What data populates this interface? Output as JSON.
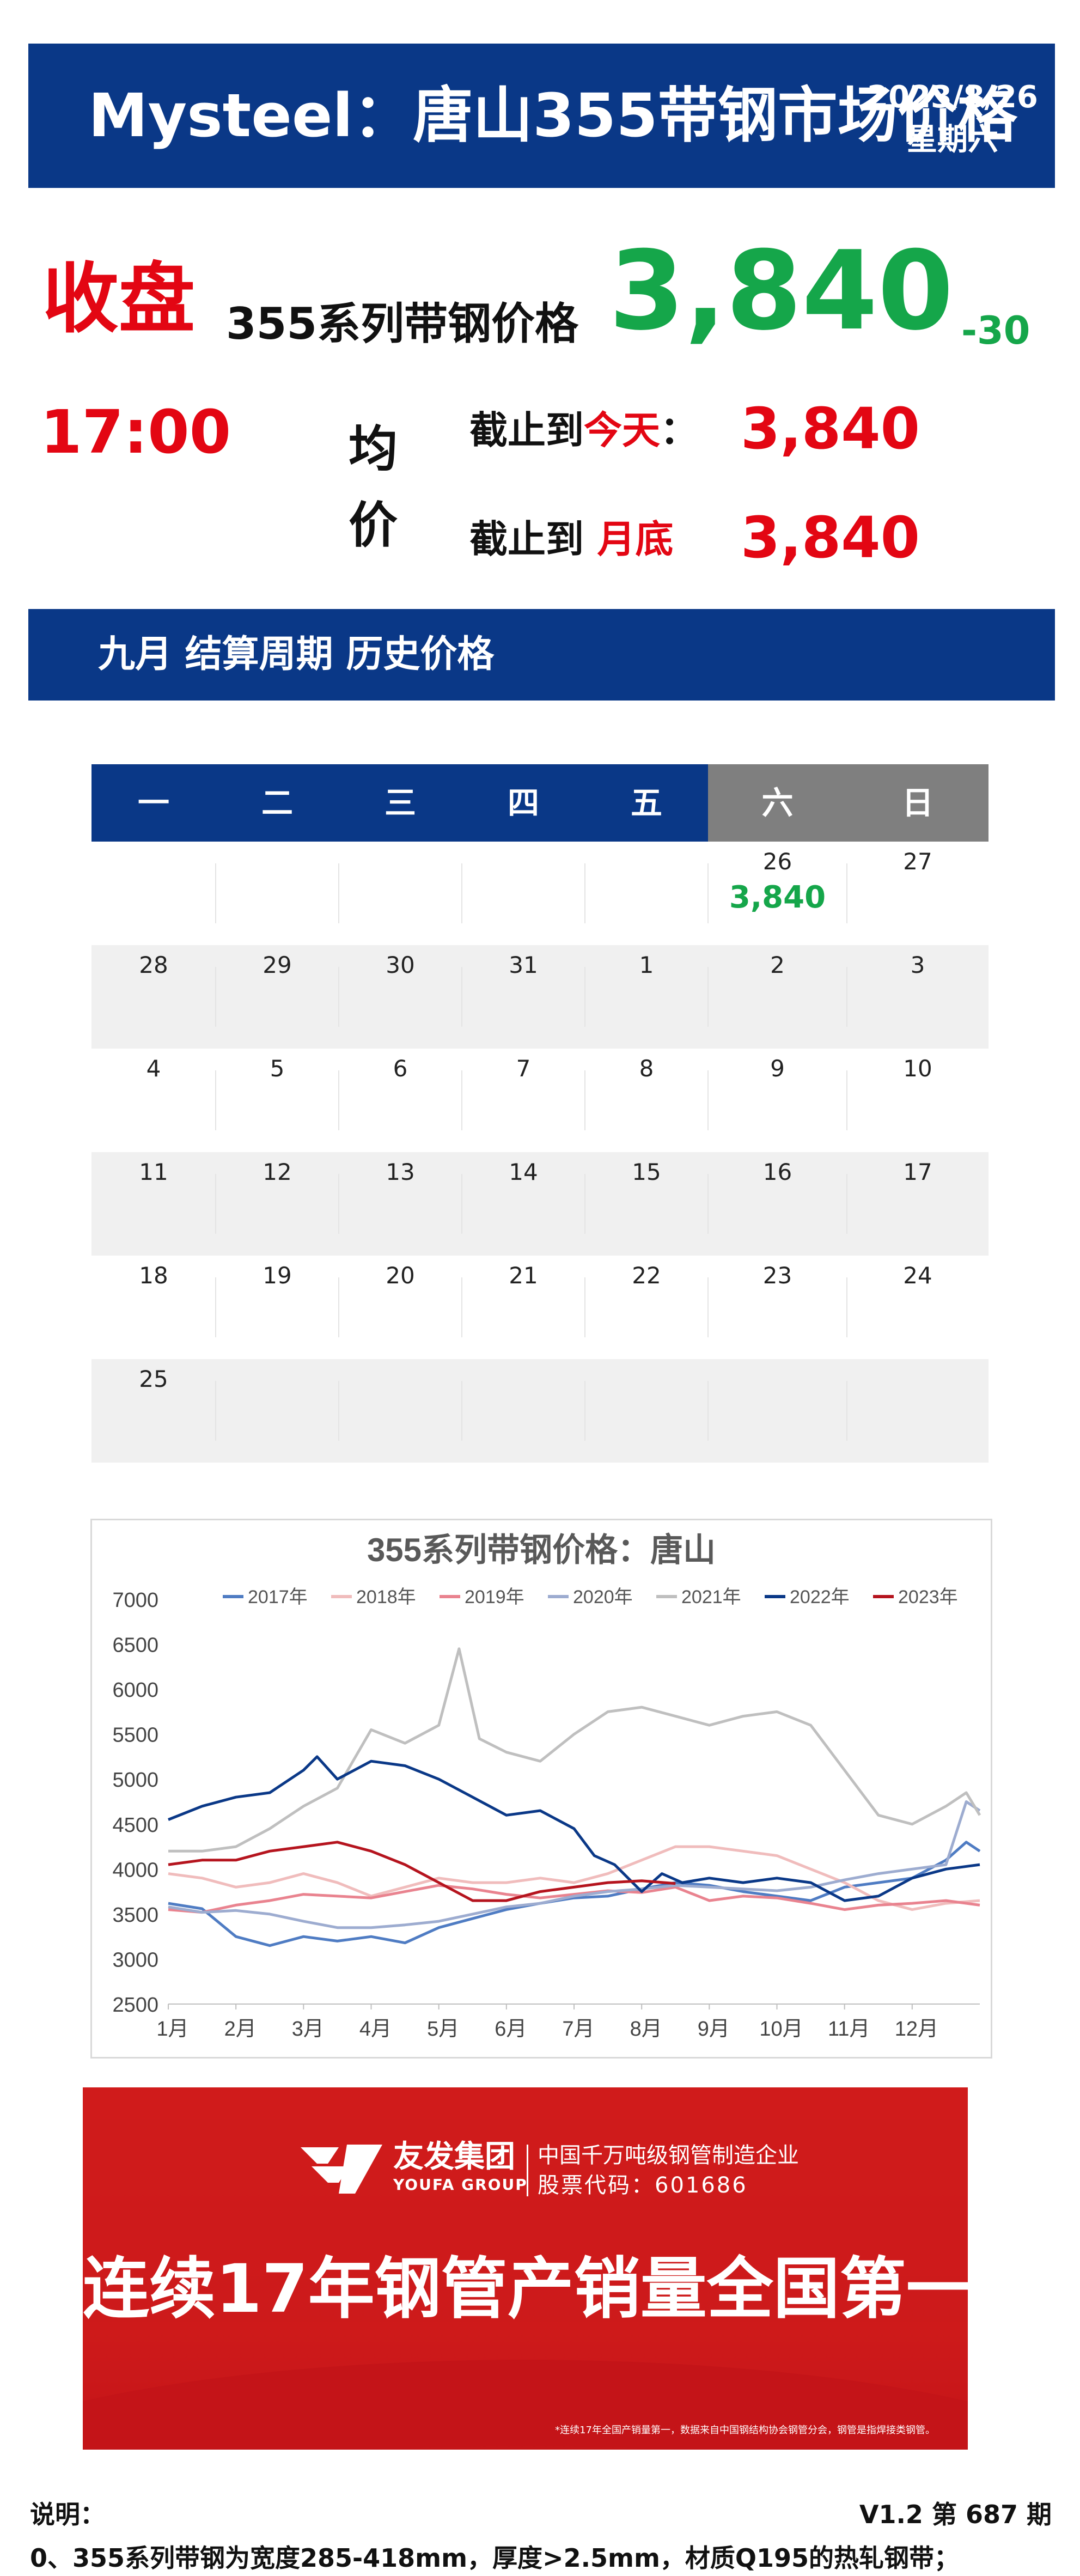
{
  "header": {
    "title": "Mysteel：唐山355带钢市场价格",
    "date": "2023/8/26",
    "weekday": "星期六"
  },
  "price": {
    "close_label": "收盘",
    "time": "17:00",
    "series_label": "355系列带钢价格",
    "value": "3,840",
    "change": "-30",
    "avg_label_1": "均",
    "avg_label_2": "价",
    "today_prefix": "截止到",
    "today_highlight": "今天",
    "today_colon": "：",
    "today_value": "3,840",
    "month_prefix": "截止到",
    "month_highlight": "月底",
    "month_value": "3,840"
  },
  "section": {
    "title": "九月 结算周期 历史价格"
  },
  "calendar": {
    "weekdays": [
      "一",
      "二",
      "三",
      "四",
      "五",
      "六",
      "日"
    ],
    "rows": [
      [
        {
          "day": ""
        },
        {
          "day": ""
        },
        {
          "day": ""
        },
        {
          "day": ""
        },
        {
          "day": ""
        },
        {
          "day": "26",
          "price": "3,840"
        },
        {
          "day": "27"
        }
      ],
      [
        {
          "day": "28"
        },
        {
          "day": "29"
        },
        {
          "day": "30"
        },
        {
          "day": "31"
        },
        {
          "day": "1"
        },
        {
          "day": "2"
        },
        {
          "day": "3"
        }
      ],
      [
        {
          "day": "4"
        },
        {
          "day": "5"
        },
        {
          "day": "6"
        },
        {
          "day": "7"
        },
        {
          "day": "8"
        },
        {
          "day": "9"
        },
        {
          "day": "10"
        }
      ],
      [
        {
          "day": "11"
        },
        {
          "day": "12"
        },
        {
          "day": "13"
        },
        {
          "day": "14"
        },
        {
          "day": "15"
        },
        {
          "day": "16"
        },
        {
          "day": "17"
        }
      ],
      [
        {
          "day": "18"
        },
        {
          "day": "19"
        },
        {
          "day": "20"
        },
        {
          "day": "21"
        },
        {
          "day": "22"
        },
        {
          "day": "23"
        },
        {
          "day": "24"
        }
      ],
      [
        {
          "day": "25"
        },
        {
          "day": ""
        },
        {
          "day": ""
        },
        {
          "day": ""
        },
        {
          "day": ""
        },
        {
          "day": ""
        },
        {
          "day": ""
        }
      ]
    ],
    "colors": {
      "weekday_bg": "#0a3887",
      "weekend_bg": "#7f7f7f"
    }
  },
  "chart_data": {
    "type": "line",
    "title": "355系列带钢价格：唐山",
    "xlabel": "",
    "ylabel": "",
    "x": [
      "1月",
      "2月",
      "3月",
      "4月",
      "5月",
      "6月",
      "7月",
      "8月",
      "9月",
      "10月",
      "11月",
      "12月"
    ],
    "ylim": [
      2500,
      7000
    ],
    "yticks": [
      2500,
      3000,
      3500,
      4000,
      4500,
      5000,
      5500,
      6000,
      6500,
      7000
    ],
    "legend_position": "top",
    "grid": false,
    "series": [
      {
        "name": "2017年",
        "color": "#4f7cc3",
        "points": [
          [
            1,
            3620
          ],
          [
            1.5,
            3560
          ],
          [
            2,
            3250
          ],
          [
            2.5,
            3150
          ],
          [
            3,
            3250
          ],
          [
            3.5,
            3200
          ],
          [
            4,
            3250
          ],
          [
            4.5,
            3180
          ],
          [
            5,
            3350
          ],
          [
            5.5,
            3450
          ],
          [
            6,
            3550
          ],
          [
            6.5,
            3620
          ],
          [
            7,
            3680
          ],
          [
            7.5,
            3700
          ],
          [
            8,
            3780
          ],
          [
            8.5,
            3850
          ],
          [
            9,
            3820
          ],
          [
            9.5,
            3750
          ],
          [
            10,
            3700
          ],
          [
            10.5,
            3650
          ],
          [
            11,
            3800
          ],
          [
            11.5,
            3850
          ],
          [
            12,
            3900
          ],
          [
            12.5,
            4100
          ],
          [
            12.8,
            4300
          ],
          [
            13,
            4200
          ]
        ]
      },
      {
        "name": "2018年",
        "color": "#f0bcbc",
        "points": [
          [
            1,
            3950
          ],
          [
            1.5,
            3900
          ],
          [
            2,
            3800
          ],
          [
            2.5,
            3850
          ],
          [
            3,
            3950
          ],
          [
            3.5,
            3850
          ],
          [
            4,
            3700
          ],
          [
            4.5,
            3800
          ],
          [
            5,
            3900
          ],
          [
            5.5,
            3850
          ],
          [
            6,
            3850
          ],
          [
            6.5,
            3900
          ],
          [
            7,
            3850
          ],
          [
            7.5,
            3950
          ],
          [
            8,
            4100
          ],
          [
            8.5,
            4250
          ],
          [
            9,
            4250
          ],
          [
            9.5,
            4200
          ],
          [
            10,
            4150
          ],
          [
            10.5,
            4000
          ],
          [
            11,
            3850
          ],
          [
            11.5,
            3650
          ],
          [
            12,
            3550
          ],
          [
            12.5,
            3620
          ],
          [
            13,
            3650
          ]
        ]
      },
      {
        "name": "2019年",
        "color": "#e9838f",
        "points": [
          [
            1,
            3550
          ],
          [
            1.5,
            3520
          ],
          [
            2,
            3600
          ],
          [
            2.5,
            3650
          ],
          [
            3,
            3720
          ],
          [
            3.5,
            3700
          ],
          [
            4,
            3680
          ],
          [
            4.5,
            3750
          ],
          [
            5,
            3820
          ],
          [
            5.5,
            3780
          ],
          [
            6,
            3720
          ],
          [
            6.5,
            3680
          ],
          [
            7,
            3720
          ],
          [
            7.5,
            3760
          ],
          [
            8,
            3740
          ],
          [
            8.5,
            3800
          ],
          [
            9,
            3650
          ],
          [
            9.5,
            3700
          ],
          [
            10,
            3680
          ],
          [
            10.5,
            3620
          ],
          [
            11,
            3550
          ],
          [
            11.5,
            3600
          ],
          [
            12,
            3620
          ],
          [
            12.5,
            3650
          ],
          [
            13,
            3600
          ]
        ]
      },
      {
        "name": "2020年",
        "color": "#9dacd0",
        "points": [
          [
            1,
            3580
          ],
          [
            1.5,
            3520
          ],
          [
            2,
            3540
          ],
          [
            2.5,
            3500
          ],
          [
            3,
            3420
          ],
          [
            3.5,
            3350
          ],
          [
            4,
            3350
          ],
          [
            4.5,
            3380
          ],
          [
            5,
            3420
          ],
          [
            5.5,
            3500
          ],
          [
            6,
            3580
          ],
          [
            6.5,
            3620
          ],
          [
            7,
            3700
          ],
          [
            7.5,
            3750
          ],
          [
            8,
            3780
          ],
          [
            8.5,
            3820
          ],
          [
            9,
            3800
          ],
          [
            9.5,
            3780
          ],
          [
            10,
            3760
          ],
          [
            10.5,
            3800
          ],
          [
            11,
            3880
          ],
          [
            11.5,
            3950
          ],
          [
            12,
            4000
          ],
          [
            12.5,
            4050
          ],
          [
            12.8,
            4750
          ],
          [
            13,
            4650
          ]
        ]
      },
      {
        "name": "2021年",
        "color": "#bfbfbf",
        "points": [
          [
            1,
            4200
          ],
          [
            1.5,
            4200
          ],
          [
            2,
            4250
          ],
          [
            2.5,
            4450
          ],
          [
            3,
            4700
          ],
          [
            3.5,
            4900
          ],
          [
            4,
            5550
          ],
          [
            4.5,
            5400
          ],
          [
            5,
            5600
          ],
          [
            5.3,
            6450
          ],
          [
            5.6,
            5450
          ],
          [
            6,
            5300
          ],
          [
            6.5,
            5200
          ],
          [
            7,
            5500
          ],
          [
            7.5,
            5750
          ],
          [
            8,
            5800
          ],
          [
            8.5,
            5700
          ],
          [
            9,
            5600
          ],
          [
            9.5,
            5700
          ],
          [
            10,
            5750
          ],
          [
            10.5,
            5600
          ],
          [
            11,
            5100
          ],
          [
            11.5,
            4600
          ],
          [
            12,
            4500
          ],
          [
            12.5,
            4700
          ],
          [
            12.8,
            4850
          ],
          [
            13,
            4600
          ]
        ]
      },
      {
        "name": "2022年",
        "color": "#0a3887",
        "points": [
          [
            1,
            4550
          ],
          [
            1.5,
            4700
          ],
          [
            2,
            4800
          ],
          [
            2.5,
            4850
          ],
          [
            3,
            5100
          ],
          [
            3.2,
            5250
          ],
          [
            3.5,
            5000
          ],
          [
            4,
            5200
          ],
          [
            4.5,
            5150
          ],
          [
            5,
            5000
          ],
          [
            5.5,
            4800
          ],
          [
            6,
            4600
          ],
          [
            6.5,
            4650
          ],
          [
            7,
            4450
          ],
          [
            7.3,
            4150
          ],
          [
            7.6,
            4050
          ],
          [
            8,
            3750
          ],
          [
            8.3,
            3950
          ],
          [
            8.6,
            3850
          ],
          [
            9,
            3900
          ],
          [
            9.5,
            3850
          ],
          [
            10,
            3900
          ],
          [
            10.5,
            3850
          ],
          [
            11,
            3650
          ],
          [
            11.5,
            3700
          ],
          [
            12,
            3900
          ],
          [
            12.5,
            4000
          ],
          [
            13,
            4050
          ]
        ]
      },
      {
        "name": "2023年",
        "color": "#b5141e",
        "points": [
          [
            1,
            4050
          ],
          [
            1.5,
            4100
          ],
          [
            2,
            4100
          ],
          [
            2.5,
            4200
          ],
          [
            3,
            4250
          ],
          [
            3.5,
            4300
          ],
          [
            4,
            4200
          ],
          [
            4.5,
            4050
          ],
          [
            5,
            3850
          ],
          [
            5.5,
            3650
          ],
          [
            6,
            3650
          ],
          [
            6.5,
            3750
          ],
          [
            7,
            3800
          ],
          [
            7.5,
            3850
          ],
          [
            8,
            3870
          ],
          [
            8.5,
            3840
          ]
        ]
      }
    ]
  },
  "ad": {
    "brand": "友发集团",
    "brand_en": "YOUFA GROUP",
    "tagline": "中国千万吨级钢管制造企业",
    "stock": "股票代码：601686",
    "slogan": "连续17年钢管产销量全国第一",
    "footnote": "*连续17年全国产销量第一，数据来自中国钢结构协会钢管分会，钢管是指焊接类钢管。"
  },
  "footer": {
    "note_label": "说明：",
    "version": "V1.2 第 687 期",
    "note_line": "0、355系列带钢为宽度285-418mm，厚度>2.5mm，材质Q195的热轧钢带；"
  }
}
